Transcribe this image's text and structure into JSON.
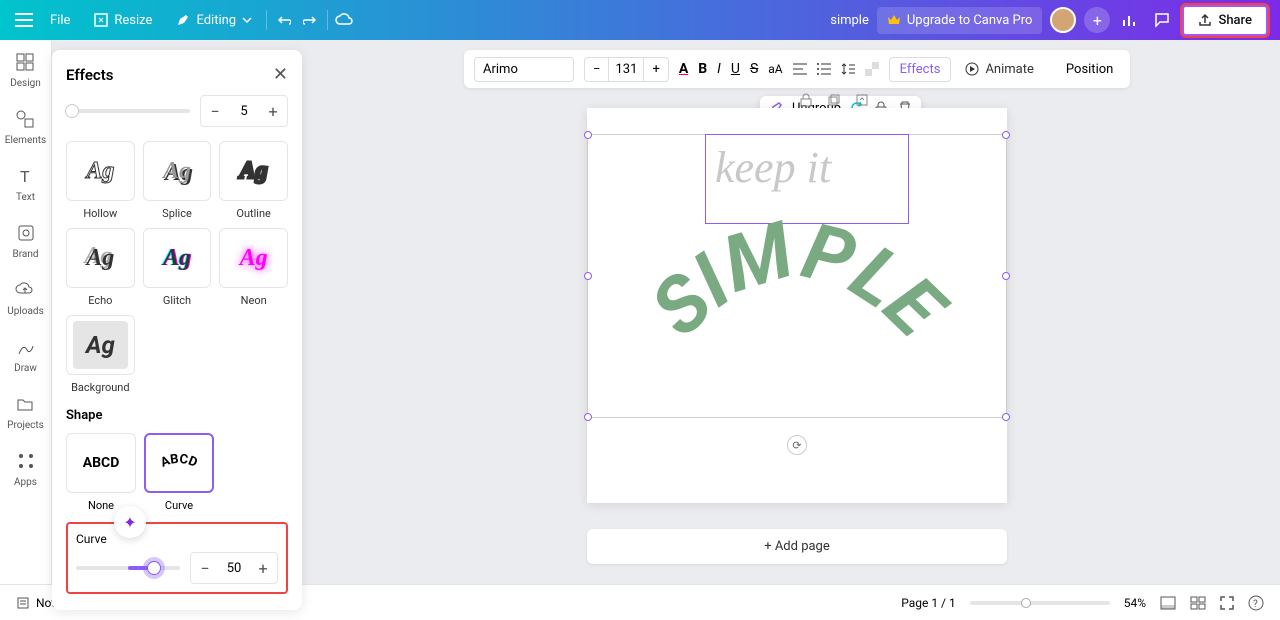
{
  "topbar": {
    "file": "File",
    "resize": "Resize",
    "editing": "Editing",
    "title": "simple",
    "upgrade": "Upgrade to Canva Pro",
    "share": "Share"
  },
  "rail": {
    "design": "Design",
    "elements": "Elements",
    "text": "Text",
    "brand": "Brand",
    "uploads": "Uploads",
    "draw": "Draw",
    "projects": "Projects",
    "apps": "Apps"
  },
  "panel": {
    "title": "Effects",
    "intensity_value": "5",
    "effects": {
      "hollow": "Hollow",
      "splice": "Splice",
      "outline": "Outline",
      "echo": "Echo",
      "glitch": "Glitch",
      "neon": "Neon",
      "background": "Background"
    },
    "shape_title": "Shape",
    "shape_none": "None",
    "shape_curve": "Curve",
    "curve_label": "Curve",
    "curve_value": "50",
    "sample_ag": "Ag",
    "sample_abcd": "ABCD"
  },
  "context_toolbar": {
    "font": "Arimo",
    "size": "131",
    "effects": "Effects",
    "animate": "Animate",
    "position": "Position"
  },
  "float_toolbar": {
    "ungroup": "Ungroup"
  },
  "canvas": {
    "keep_it": "keep it",
    "simple": "SIMPLE",
    "add_page": "+ Add page"
  },
  "bottombar": {
    "notes": "Notes",
    "page_indicator": "Page 1 / 1",
    "zoom": "54%"
  }
}
